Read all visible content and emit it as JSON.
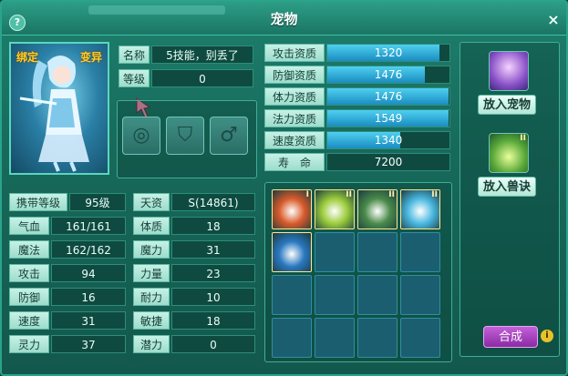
{
  "window": {
    "title": "宠物"
  },
  "portrait": {
    "tag_bound": "绑定",
    "tag_mutant": "变异"
  },
  "info": {
    "name_label": "名称",
    "name_value": "5技能，别丢了",
    "level_label": "等级",
    "level_value": "0"
  },
  "aptitudes": [
    {
      "label": "攻击资质",
      "value": "1320",
      "fill": 0.92
    },
    {
      "label": "防御资质",
      "value": "1476",
      "fill": 0.8
    },
    {
      "label": "体力资质",
      "value": "1476",
      "fill": 0.99
    },
    {
      "label": "法力资质",
      "value": "1549",
      "fill": 0.99
    },
    {
      "label": "速度资质",
      "value": "1340",
      "fill": 0.6
    },
    {
      "label": "寿　命",
      "value": "7200",
      "fill": 0
    }
  ],
  "stats_left": [
    {
      "label": "携带等级",
      "value": "95级"
    },
    {
      "label": "气血",
      "value": "161/161"
    },
    {
      "label": "魔法",
      "value": "162/162"
    },
    {
      "label": "攻击",
      "value": "94"
    },
    {
      "label": "防御",
      "value": "16"
    },
    {
      "label": "速度",
      "value": "31"
    },
    {
      "label": "灵力",
      "value": "37"
    }
  ],
  "stats_right": [
    {
      "label": "天资",
      "value": "S(14861)"
    },
    {
      "label": "体质",
      "value": "18"
    },
    {
      "label": "魔力",
      "value": "31"
    },
    {
      "label": "力量",
      "value": "23"
    },
    {
      "label": "耐力",
      "value": "10"
    },
    {
      "label": "敏捷",
      "value": "18"
    },
    {
      "label": "潜力",
      "value": "0"
    }
  ],
  "skills": [
    {
      "level": "I",
      "color": "#d85a2a"
    },
    {
      "level": "II",
      "color": "#9acb3a"
    },
    {
      "level": "II",
      "color": "#4a8a4a"
    },
    {
      "level": "II",
      "color": "#4ab8e0"
    },
    {
      "level": "",
      "color": "#2a78c0"
    }
  ],
  "right_panel": {
    "add_pet": "放入宠物",
    "add_book": "放入兽诀",
    "book_level": "II"
  },
  "combine": "合成",
  "help": "?",
  "close": "×",
  "info_icon": "i"
}
